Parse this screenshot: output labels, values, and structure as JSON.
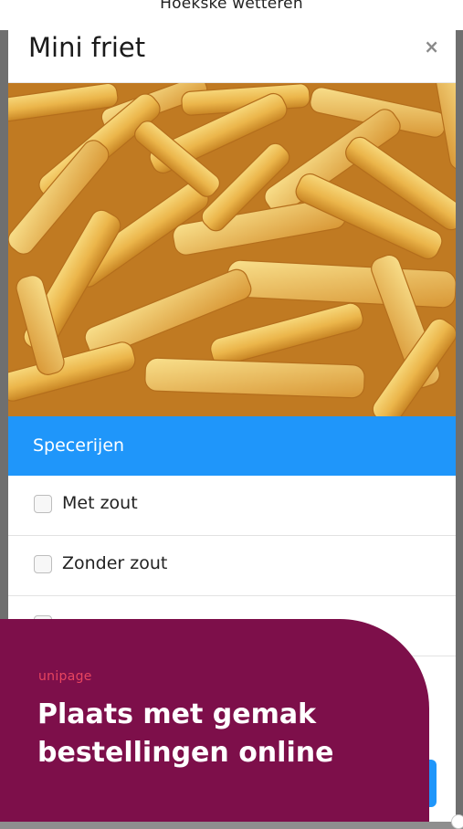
{
  "page": {
    "site_title": "Hoekske wetteren"
  },
  "modal": {
    "title": "Mini friet",
    "close_symbol": "×",
    "image_alt": "Mini friet",
    "section_title": "Specerijen",
    "options": [
      {
        "label": "Met zout",
        "checked": false
      },
      {
        "label": "Zonder zout",
        "checked": false
      },
      {
        "label": "",
        "checked": false
      }
    ]
  },
  "promo": {
    "brand": "unipage",
    "text": "Plaats met gemak bestellingen online",
    "background_color": "#7d0f4a",
    "brand_color": "#e8455f"
  },
  "colors": {
    "section_bar": "#1f96fa",
    "modal_background": "#ffffff",
    "overlay": "#8e8e8e"
  }
}
